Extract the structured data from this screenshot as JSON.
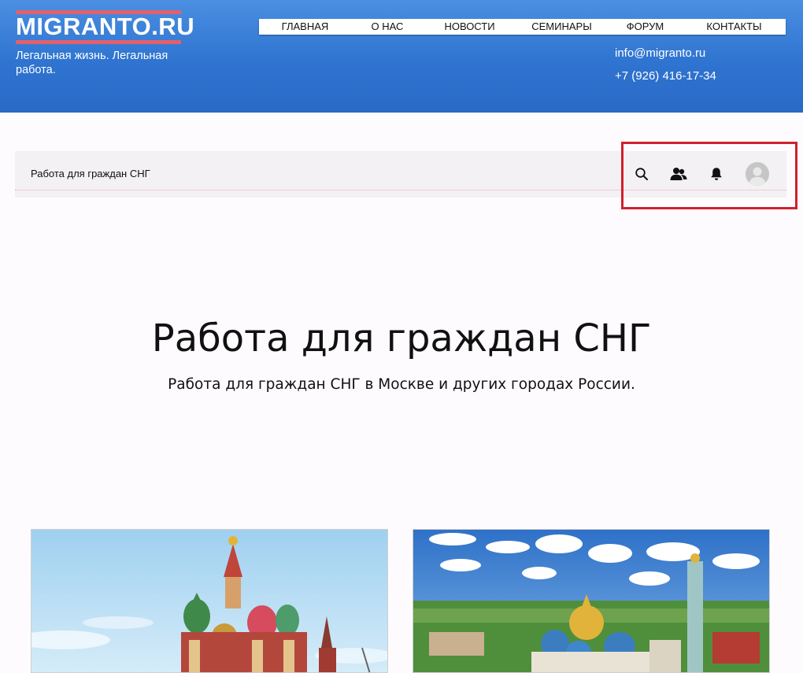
{
  "site": {
    "logo_text": "MIGRANTO.RU",
    "tagline": "Легальная жизнь. Легальная работа."
  },
  "topnav": {
    "items": [
      {
        "label": "ГЛАВНАЯ"
      },
      {
        "label": "О НАС"
      },
      {
        "label": "НОВОСТИ"
      },
      {
        "label": "СЕМИНАРЫ"
      },
      {
        "label": "ФОРУМ"
      },
      {
        "label": "КОНТАКТЫ"
      }
    ]
  },
  "contacts": {
    "email": "info@migranto.ru",
    "phone": "+7 (926) 416-17-34"
  },
  "sitebar": {
    "title": "Работа для граждан СНГ",
    "icons": [
      "search-icon",
      "members-icon",
      "notifications-bell-icon",
      "user-avatar"
    ]
  },
  "hero": {
    "title": "Работа для граждан СНГ",
    "subtitle": "Работа для граждан СНГ в Москве и других городах России."
  },
  "colors": {
    "header_blue": "#2f74d0",
    "logo_accent": "#e2606e",
    "highlight_red": "#d0202e"
  }
}
